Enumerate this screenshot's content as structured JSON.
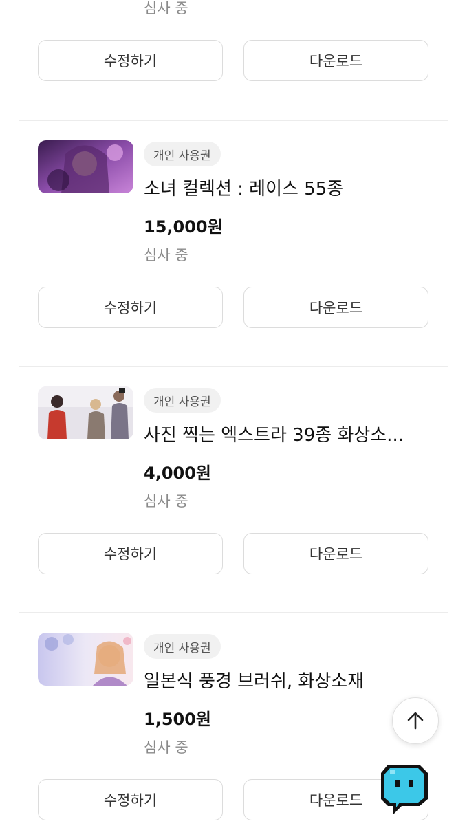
{
  "top": {
    "status": "심사 중",
    "edit_label": "수정하기",
    "download_label": "다운로드"
  },
  "items": [
    {
      "badge": "개인 사용권",
      "title": "소녀 컬렉션 : 레이스 55종",
      "price": "15,000원",
      "status": "심사 중",
      "edit_label": "수정하기",
      "download_label": "다운로드"
    },
    {
      "badge": "개인 사용권",
      "title": "사진 찍는 엑스트라 39종 화상소...",
      "price": "4,000원",
      "status": "심사 중",
      "edit_label": "수정하기",
      "download_label": "다운로드"
    },
    {
      "badge": "개인 사용권",
      "title": "일본식 풍경 브러쉬, 화상소재",
      "price": "1,500원",
      "status": "심사 중",
      "edit_label": "수정하기",
      "download_label": "다운로드"
    }
  ],
  "icons": {
    "scroll_top": "arrow-up-icon",
    "chat": "chat-bot-icon"
  },
  "colors": {
    "chat_bot": "#3cc8e8",
    "divider": "#ececec",
    "badge_bg": "#f1f1f1"
  }
}
